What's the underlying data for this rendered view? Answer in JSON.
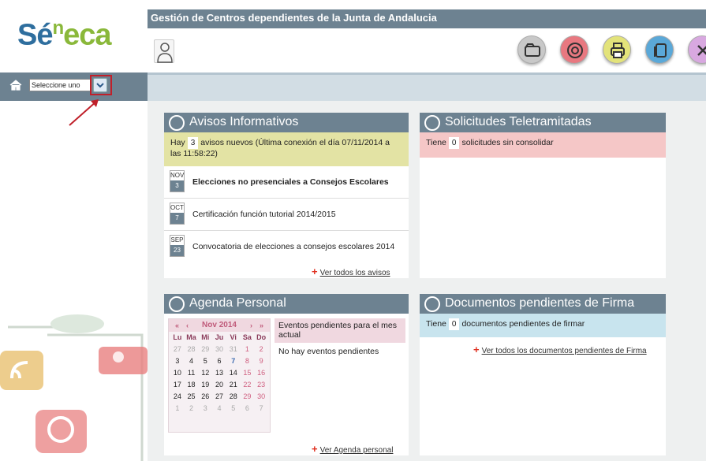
{
  "app": {
    "logo_main": "Sé",
    "logo_sup": "n",
    "logo_rest": "eca",
    "title": "Gestión de Centros dependientes de la Junta de Andalucia"
  },
  "selector": {
    "value": "Seleccione uno"
  },
  "toolbar": {
    "icons": [
      "folder-icon",
      "lifebuoy-icon",
      "printer-icon",
      "copy-icon",
      "close-icon"
    ]
  },
  "avisos": {
    "title": "Avisos Informativos",
    "info_pre": "Hay",
    "info_count": "3",
    "info_post": "avisos nuevos (Última conexión el día 07/11/2014 a las 11:58:22)",
    "items": [
      {
        "month": "NOV",
        "day": "3",
        "title": "Elecciones no presenciales a Consejos Escolares"
      },
      {
        "month": "OCT",
        "day": "7",
        "title": "Certificación función tutorial 2014/2015"
      },
      {
        "month": "SEP",
        "day": "23",
        "title": "Convocatoria de elecciones a consejos escolares 2014"
      }
    ],
    "link": "Ver todos los avisos"
  },
  "solicitudes": {
    "title": "Solicitudes Teletramitadas",
    "info_pre": "Tiene",
    "info_count": "0",
    "info_post": "solicitudes sin consolidar"
  },
  "agenda": {
    "title": "Agenda Personal",
    "calendar": {
      "month": "Nov 2014",
      "nav_prev2": "«",
      "nav_prev": "‹",
      "nav_next": "›",
      "nav_next2": "»",
      "dow": [
        "Lu",
        "Ma",
        "Mi",
        "Ju",
        "Vi",
        "Sa",
        "Do"
      ],
      "weeks": [
        [
          "27",
          "28",
          "29",
          "30",
          "31",
          "1",
          "2"
        ],
        [
          "3",
          "4",
          "5",
          "6",
          "7",
          "8",
          "9"
        ],
        [
          "10",
          "11",
          "12",
          "13",
          "14",
          "15",
          "16"
        ],
        [
          "17",
          "18",
          "19",
          "20",
          "21",
          "22",
          "23"
        ],
        [
          "24",
          "25",
          "26",
          "27",
          "28",
          "29",
          "30"
        ],
        [
          "1",
          "2",
          "3",
          "4",
          "5",
          "6",
          "7"
        ]
      ]
    },
    "events_head": "Eventos pendientes para el mes actual",
    "events_body": "No hay eventos pendientes",
    "link": "Ver Agenda personal"
  },
  "documentos": {
    "title": "Documentos pendientes de Firma",
    "info_pre": "Tiene",
    "info_count": "0",
    "info_post": "documentos pendientes de firmar",
    "link": "Ver todos los documentos pendientes de Firma"
  }
}
